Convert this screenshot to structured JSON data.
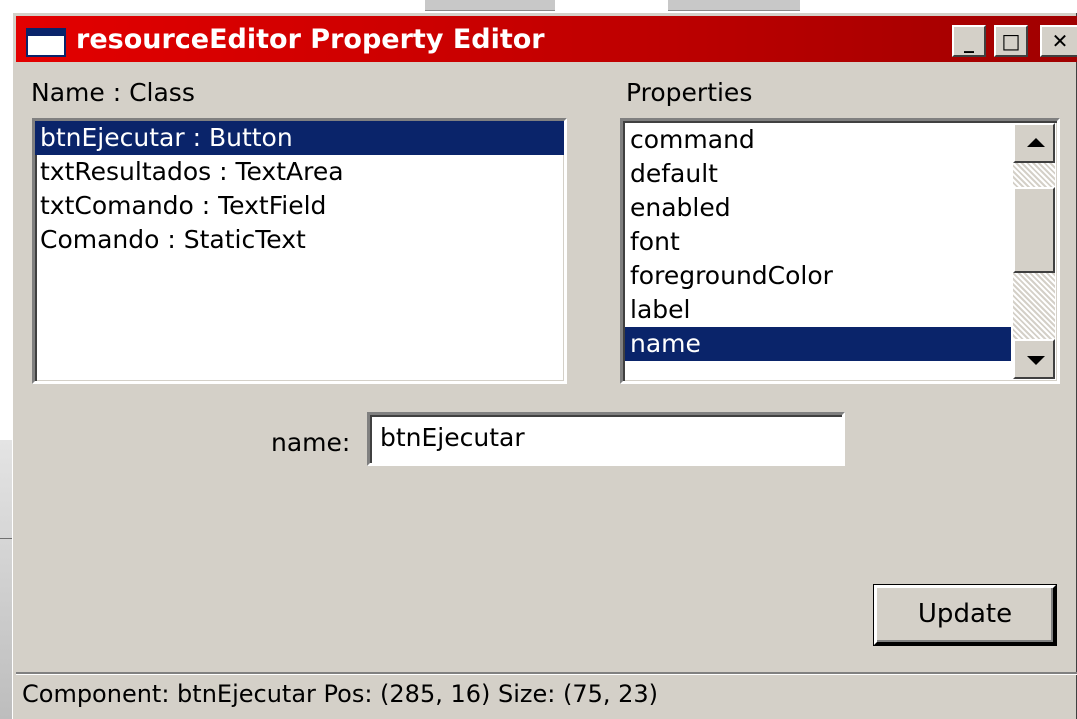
{
  "window": {
    "title": "resourceEditor Property Editor",
    "controls": {
      "minimize": "_",
      "maximize": "□",
      "close": "✕"
    },
    "accent_color": "#e30000"
  },
  "components": {
    "header": "Name  :  Class",
    "items": [
      {
        "label": "btnEjecutar  :  Button",
        "selected": true
      },
      {
        "label": "txtResultados  :  TextArea",
        "selected": false
      },
      {
        "label": "txtComando  :  TextField",
        "selected": false
      },
      {
        "label": "Comando  :  StaticText",
        "selected": false
      }
    ]
  },
  "properties": {
    "header": "Properties",
    "items": [
      {
        "label": "command",
        "selected": false
      },
      {
        "label": "default",
        "selected": false
      },
      {
        "label": "enabled",
        "selected": false
      },
      {
        "label": "font",
        "selected": false
      },
      {
        "label": "foregroundColor",
        "selected": false
      },
      {
        "label": "label",
        "selected": false
      },
      {
        "label": "name",
        "selected": true
      }
    ]
  },
  "editor": {
    "field_label": "name:",
    "field_value": "btnEjecutar",
    "update_label": "Update"
  },
  "status": {
    "text": "Component: btnEjecutar  Pos: (285, 16)  Size: (75, 23)"
  },
  "icons": [
    "window-icon",
    "minimize-icon",
    "maximize-icon",
    "close-icon",
    "scroll-up-icon",
    "scroll-down-icon"
  ]
}
